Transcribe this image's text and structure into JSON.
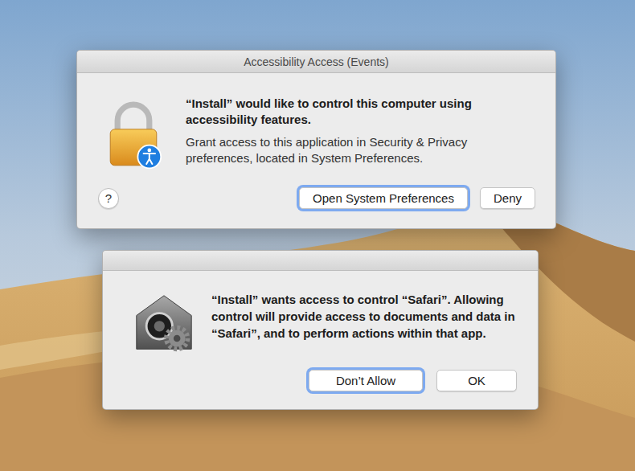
{
  "accessibility_dialog": {
    "title": "Accessibility Access (Events)",
    "heading": "“Install” would like to control this computer using accessibility features.",
    "message": "Grant access to this application in Security & Privacy preferences, located in System Preferences.",
    "help": "?",
    "buttons": [
      {
        "label": "Open System Preferences",
        "focused": true
      },
      {
        "label": "Deny",
        "focused": false
      }
    ]
  },
  "automation_dialog": {
    "message": "“Install” wants access to control “Safari”. Allowing control will provide access to documents and data in “Safari”, and to perform actions within that app.",
    "buttons": [
      {
        "label": "Don’t Allow",
        "focused": true
      },
      {
        "label": "OK",
        "focused": false
      }
    ]
  }
}
